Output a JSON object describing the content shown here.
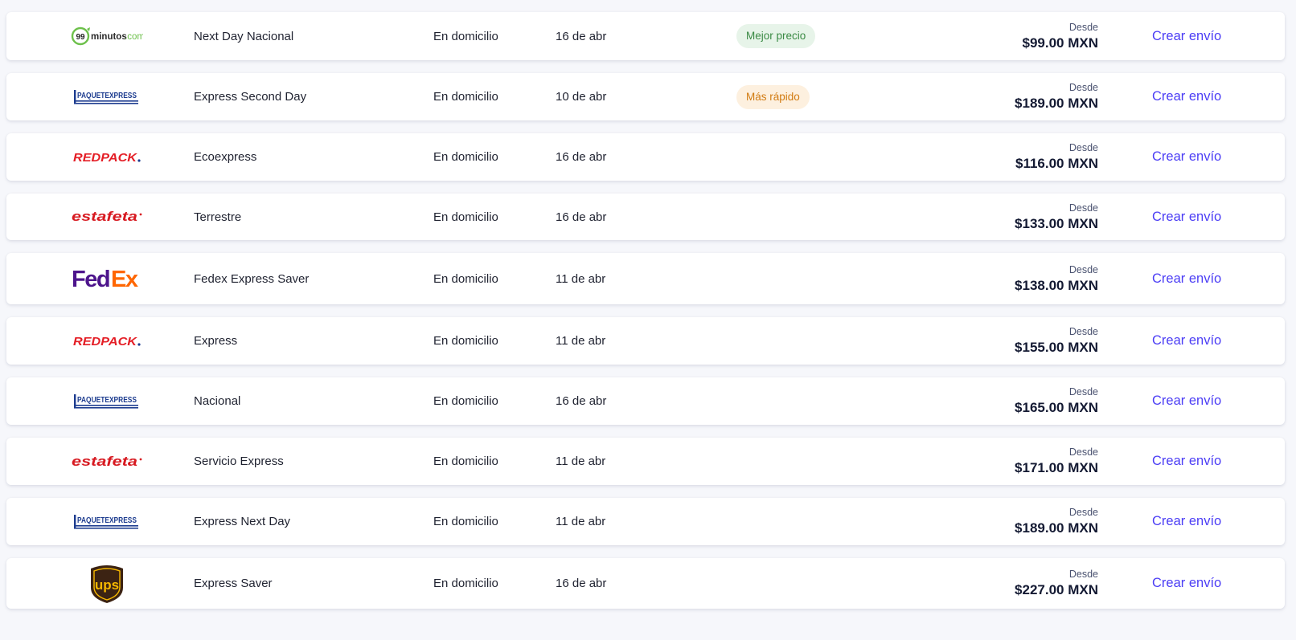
{
  "rows": [
    {
      "carrier_icon": "99minutos-logo-icon",
      "carrier_text": "99minutos.com",
      "service": "Next Day Nacional",
      "delivery": "En domicilio",
      "date": "16 de abr",
      "badge": "Mejor precio",
      "badge_kind": "best",
      "from": "Desde",
      "price": "$99.00 MXN",
      "cta": "Crear envío"
    },
    {
      "carrier_icon": "paquetexpress-logo-icon",
      "carrier_text": "PAQUETEXPRESS",
      "service": "Express Second Day",
      "delivery": "En domicilio",
      "date": "10 de abr",
      "badge": "Más rápido",
      "badge_kind": "fast",
      "from": "Desde",
      "price": "$189.00 MXN",
      "cta": "Crear envío"
    },
    {
      "carrier_icon": "redpack-logo-icon",
      "carrier_text": "REDPACK",
      "service": "Ecoexpress",
      "delivery": "En domicilio",
      "date": "16 de abr",
      "badge": "",
      "badge_kind": "",
      "from": "Desde",
      "price": "$116.00 MXN",
      "cta": "Crear envío"
    },
    {
      "carrier_icon": "estafeta-logo-icon",
      "carrier_text": "estafeta",
      "service": "Terrestre",
      "delivery": "En domicilio",
      "date": "16 de abr",
      "badge": "",
      "badge_kind": "",
      "from": "Desde",
      "price": "$133.00 MXN",
      "cta": "Crear envío"
    },
    {
      "carrier_icon": "fedex-logo-icon",
      "carrier_text": "FedEx",
      "service": "Fedex Express Saver",
      "delivery": "En domicilio",
      "date": "11 de abr",
      "badge": "",
      "badge_kind": "",
      "from": "Desde",
      "price": "$138.00 MXN",
      "cta": "Crear envío"
    },
    {
      "carrier_icon": "redpack-logo-icon",
      "carrier_text": "REDPACK",
      "service": "Express",
      "delivery": "En domicilio",
      "date": "11 de abr",
      "badge": "",
      "badge_kind": "",
      "from": "Desde",
      "price": "$155.00 MXN",
      "cta": "Crear envío"
    },
    {
      "carrier_icon": "paquetexpress-logo-icon",
      "carrier_text": "PAQUETEXPRESS",
      "service": "Nacional",
      "delivery": "En domicilio",
      "date": "16 de abr",
      "badge": "",
      "badge_kind": "",
      "from": "Desde",
      "price": "$165.00 MXN",
      "cta": "Crear envío"
    },
    {
      "carrier_icon": "estafeta-logo-icon",
      "carrier_text": "estafeta",
      "service": "Servicio Express",
      "delivery": "En domicilio",
      "date": "11 de abr",
      "badge": "",
      "badge_kind": "",
      "from": "Desde",
      "price": "$171.00 MXN",
      "cta": "Crear envío"
    },
    {
      "carrier_icon": "paquetexpress-logo-icon",
      "carrier_text": "PAQUETEXPRESS",
      "service": "Express Next Day",
      "delivery": "En domicilio",
      "date": "11 de abr",
      "badge": "",
      "badge_kind": "",
      "from": "Desde",
      "price": "$189.00 MXN",
      "cta": "Crear envío"
    },
    {
      "carrier_icon": "ups-logo-icon",
      "carrier_text": "ups",
      "service": "Express Saver",
      "delivery": "En domicilio",
      "date": "16 de abr",
      "badge": "",
      "badge_kind": "",
      "from": "Desde",
      "price": "$227.00 MXN",
      "cta": "Crear envío"
    }
  ],
  "colors": {
    "cta": "#4b3df5",
    "best_bg": "#e7f4e9",
    "best_fg": "#3a8a44",
    "fast_bg": "#fdf0df",
    "fast_fg": "#d17b12",
    "ninety_nine_green": "#6cc04a",
    "paquetexpress_blue": "#1d3c8f",
    "redpack_red": "#e41e26",
    "estafeta_red": "#d71920",
    "fedex_purple": "#4d148c",
    "fedex_orange": "#ff6600",
    "ups_brown": "#3c2313",
    "ups_gold": "#f7b800"
  }
}
